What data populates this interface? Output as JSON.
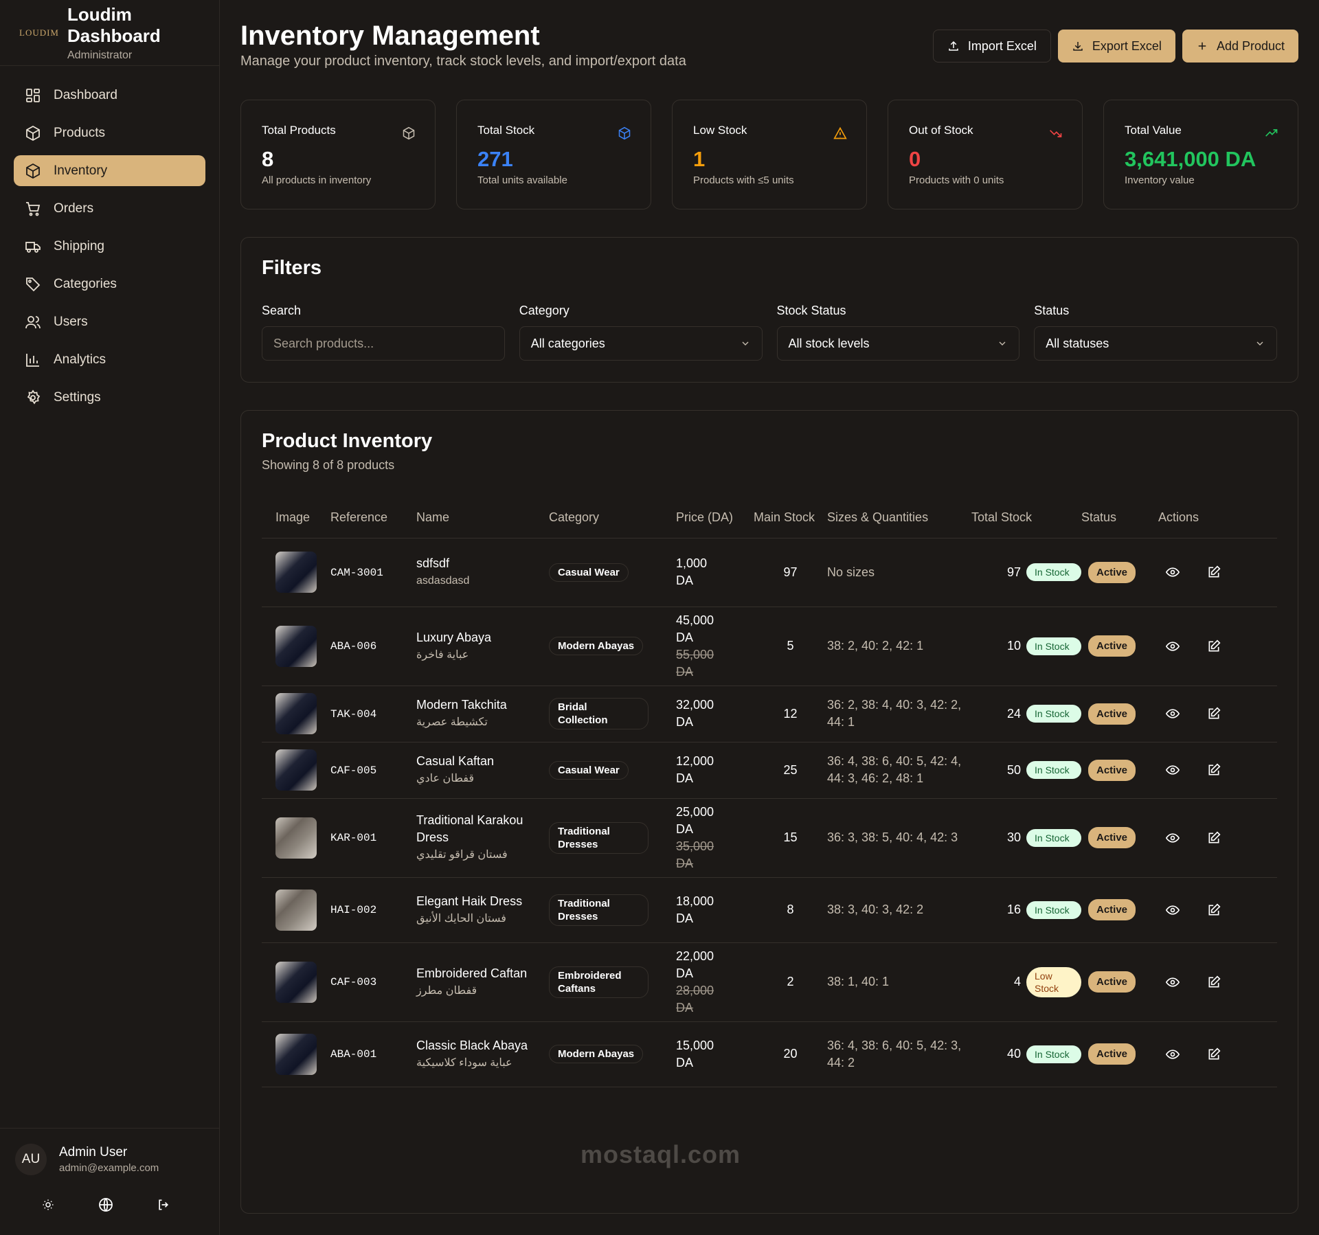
{
  "sidebar": {
    "logo_text": "LOUDIM",
    "brand_title": "Loudim Dashboard",
    "brand_subtitle": "Administrator",
    "items": [
      {
        "label": "Dashboard",
        "icon": "grid-icon"
      },
      {
        "label": "Products",
        "icon": "box-icon"
      },
      {
        "label": "Inventory",
        "icon": "box-icon",
        "active": true
      },
      {
        "label": "Orders",
        "icon": "cart-icon"
      },
      {
        "label": "Shipping",
        "icon": "truck-icon"
      },
      {
        "label": "Categories",
        "icon": "tag-icon"
      },
      {
        "label": "Users",
        "icon": "users-icon"
      },
      {
        "label": "Analytics",
        "icon": "bar-chart-icon"
      },
      {
        "label": "Settings",
        "icon": "gear-icon"
      }
    ],
    "user": {
      "initials": "AU",
      "name": "Admin User",
      "email": "admin@example.com"
    }
  },
  "header": {
    "title": "Inventory Management",
    "subtitle": "Manage your product inventory, track stock levels, and import/export data",
    "import_label": "Import Excel",
    "export_label": "Export Excel",
    "add_label": "Add Product"
  },
  "colors": {
    "accent": "#d9b47c",
    "blue": "#3b82f6",
    "orange": "#f59e0b",
    "red": "#ef4444",
    "green": "#22c55e"
  },
  "stats": [
    {
      "label": "Total Products",
      "value": "8",
      "note": "All products in inventory"
    },
    {
      "label": "Total Stock",
      "value": "271",
      "note": "Total units available"
    },
    {
      "label": "Low Stock",
      "value": "1",
      "note": "Products with ≤5 units"
    },
    {
      "label": "Out of Stock",
      "value": "0",
      "note": "Products with 0 units"
    },
    {
      "label": "Total Value",
      "value": "3,641,000 DA",
      "note": "Inventory value"
    }
  ],
  "filters": {
    "title": "Filters",
    "search_label": "Search",
    "search_placeholder": "Search products...",
    "category_label": "Category",
    "category_value": "All categories",
    "stock_label": "Stock Status",
    "stock_value": "All stock levels",
    "status_label": "Status",
    "status_value": "All statuses"
  },
  "inventory": {
    "title": "Product Inventory",
    "subtitle": "Showing 8 of 8 products",
    "columns": [
      "Image",
      "Reference",
      "Name",
      "Category",
      "Price (DA)",
      "Main Stock",
      "Sizes & Quantities",
      "Total Stock",
      "Status",
      "Actions"
    ],
    "rows": [
      {
        "ref": "CAM-3001",
        "name": "sdfsdf",
        "sub": "asdasdasd",
        "category": "Casual Wear",
        "price": "1,000 DA",
        "old_price": "",
        "main": "97",
        "sizes": "No sizes",
        "total": "97",
        "badge": "In Stock",
        "status": "Active"
      },
      {
        "ref": "ABA-006",
        "name": "Luxury Abaya",
        "sub": "عباية فاخرة",
        "category": "Modern Abayas",
        "price": "45,000 DA",
        "old_price": "55,000 DA",
        "main": "5",
        "sizes": "38: 2, 40: 2, 42: 1",
        "total": "10",
        "badge": "In Stock",
        "status": "Active"
      },
      {
        "ref": "TAK-004",
        "name": "Modern Takchita",
        "sub": "تكشيطة عصرية",
        "category": "Bridal Collection",
        "price": "32,000 DA",
        "old_price": "",
        "main": "12",
        "sizes": "36: 2, 38: 4, 40: 3, 42: 2, 44: 1",
        "total": "24",
        "badge": "In Stock",
        "status": "Active"
      },
      {
        "ref": "CAF-005",
        "name": "Casual Kaftan",
        "sub": "قفطان عادي",
        "category": "Casual Wear",
        "price": "12,000 DA",
        "old_price": "",
        "main": "25",
        "sizes": "36: 4, 38: 6, 40: 5, 42: 4, 44: 3, 46: 2, 48: 1",
        "total": "50",
        "badge": "In Stock",
        "status": "Active"
      },
      {
        "ref": "KAR-001",
        "name": "Traditional Karakou Dress",
        "sub": "فستان قراقو تقليدي",
        "category": "Traditional Dresses",
        "price": "25,000 DA",
        "old_price": "35,000 DA",
        "main": "15",
        "sizes": "36: 3, 38: 5, 40: 4, 42: 3",
        "total": "30",
        "badge": "In Stock",
        "status": "Active"
      },
      {
        "ref": "HAI-002",
        "name": "Elegant Haik Dress",
        "sub": "فستان الحايك الأنيق",
        "category": "Traditional Dresses",
        "price": "18,000 DA",
        "old_price": "",
        "main": "8",
        "sizes": "38: 3, 40: 3, 42: 2",
        "total": "16",
        "badge": "In Stock",
        "status": "Active"
      },
      {
        "ref": "CAF-003",
        "name": "Embroidered Caftan",
        "sub": "قفطان مطرز",
        "category": "Embroidered Caftans",
        "price": "22,000 DA",
        "old_price": "28,000 DA",
        "main": "2",
        "sizes": "38: 1, 40: 1",
        "total": "4",
        "badge": "Low Stock",
        "status": "Active"
      },
      {
        "ref": "ABA-001",
        "name": "Classic Black Abaya",
        "sub": "عباية سوداء كلاسيكية",
        "category": "Modern Abayas",
        "price": "15,000 DA",
        "old_price": "",
        "main": "20",
        "sizes": "36: 4, 38: 6, 40: 5, 42: 3, 44: 2",
        "total": "40",
        "badge": "In Stock",
        "status": "Active"
      }
    ]
  },
  "watermark": "mostaql.com"
}
